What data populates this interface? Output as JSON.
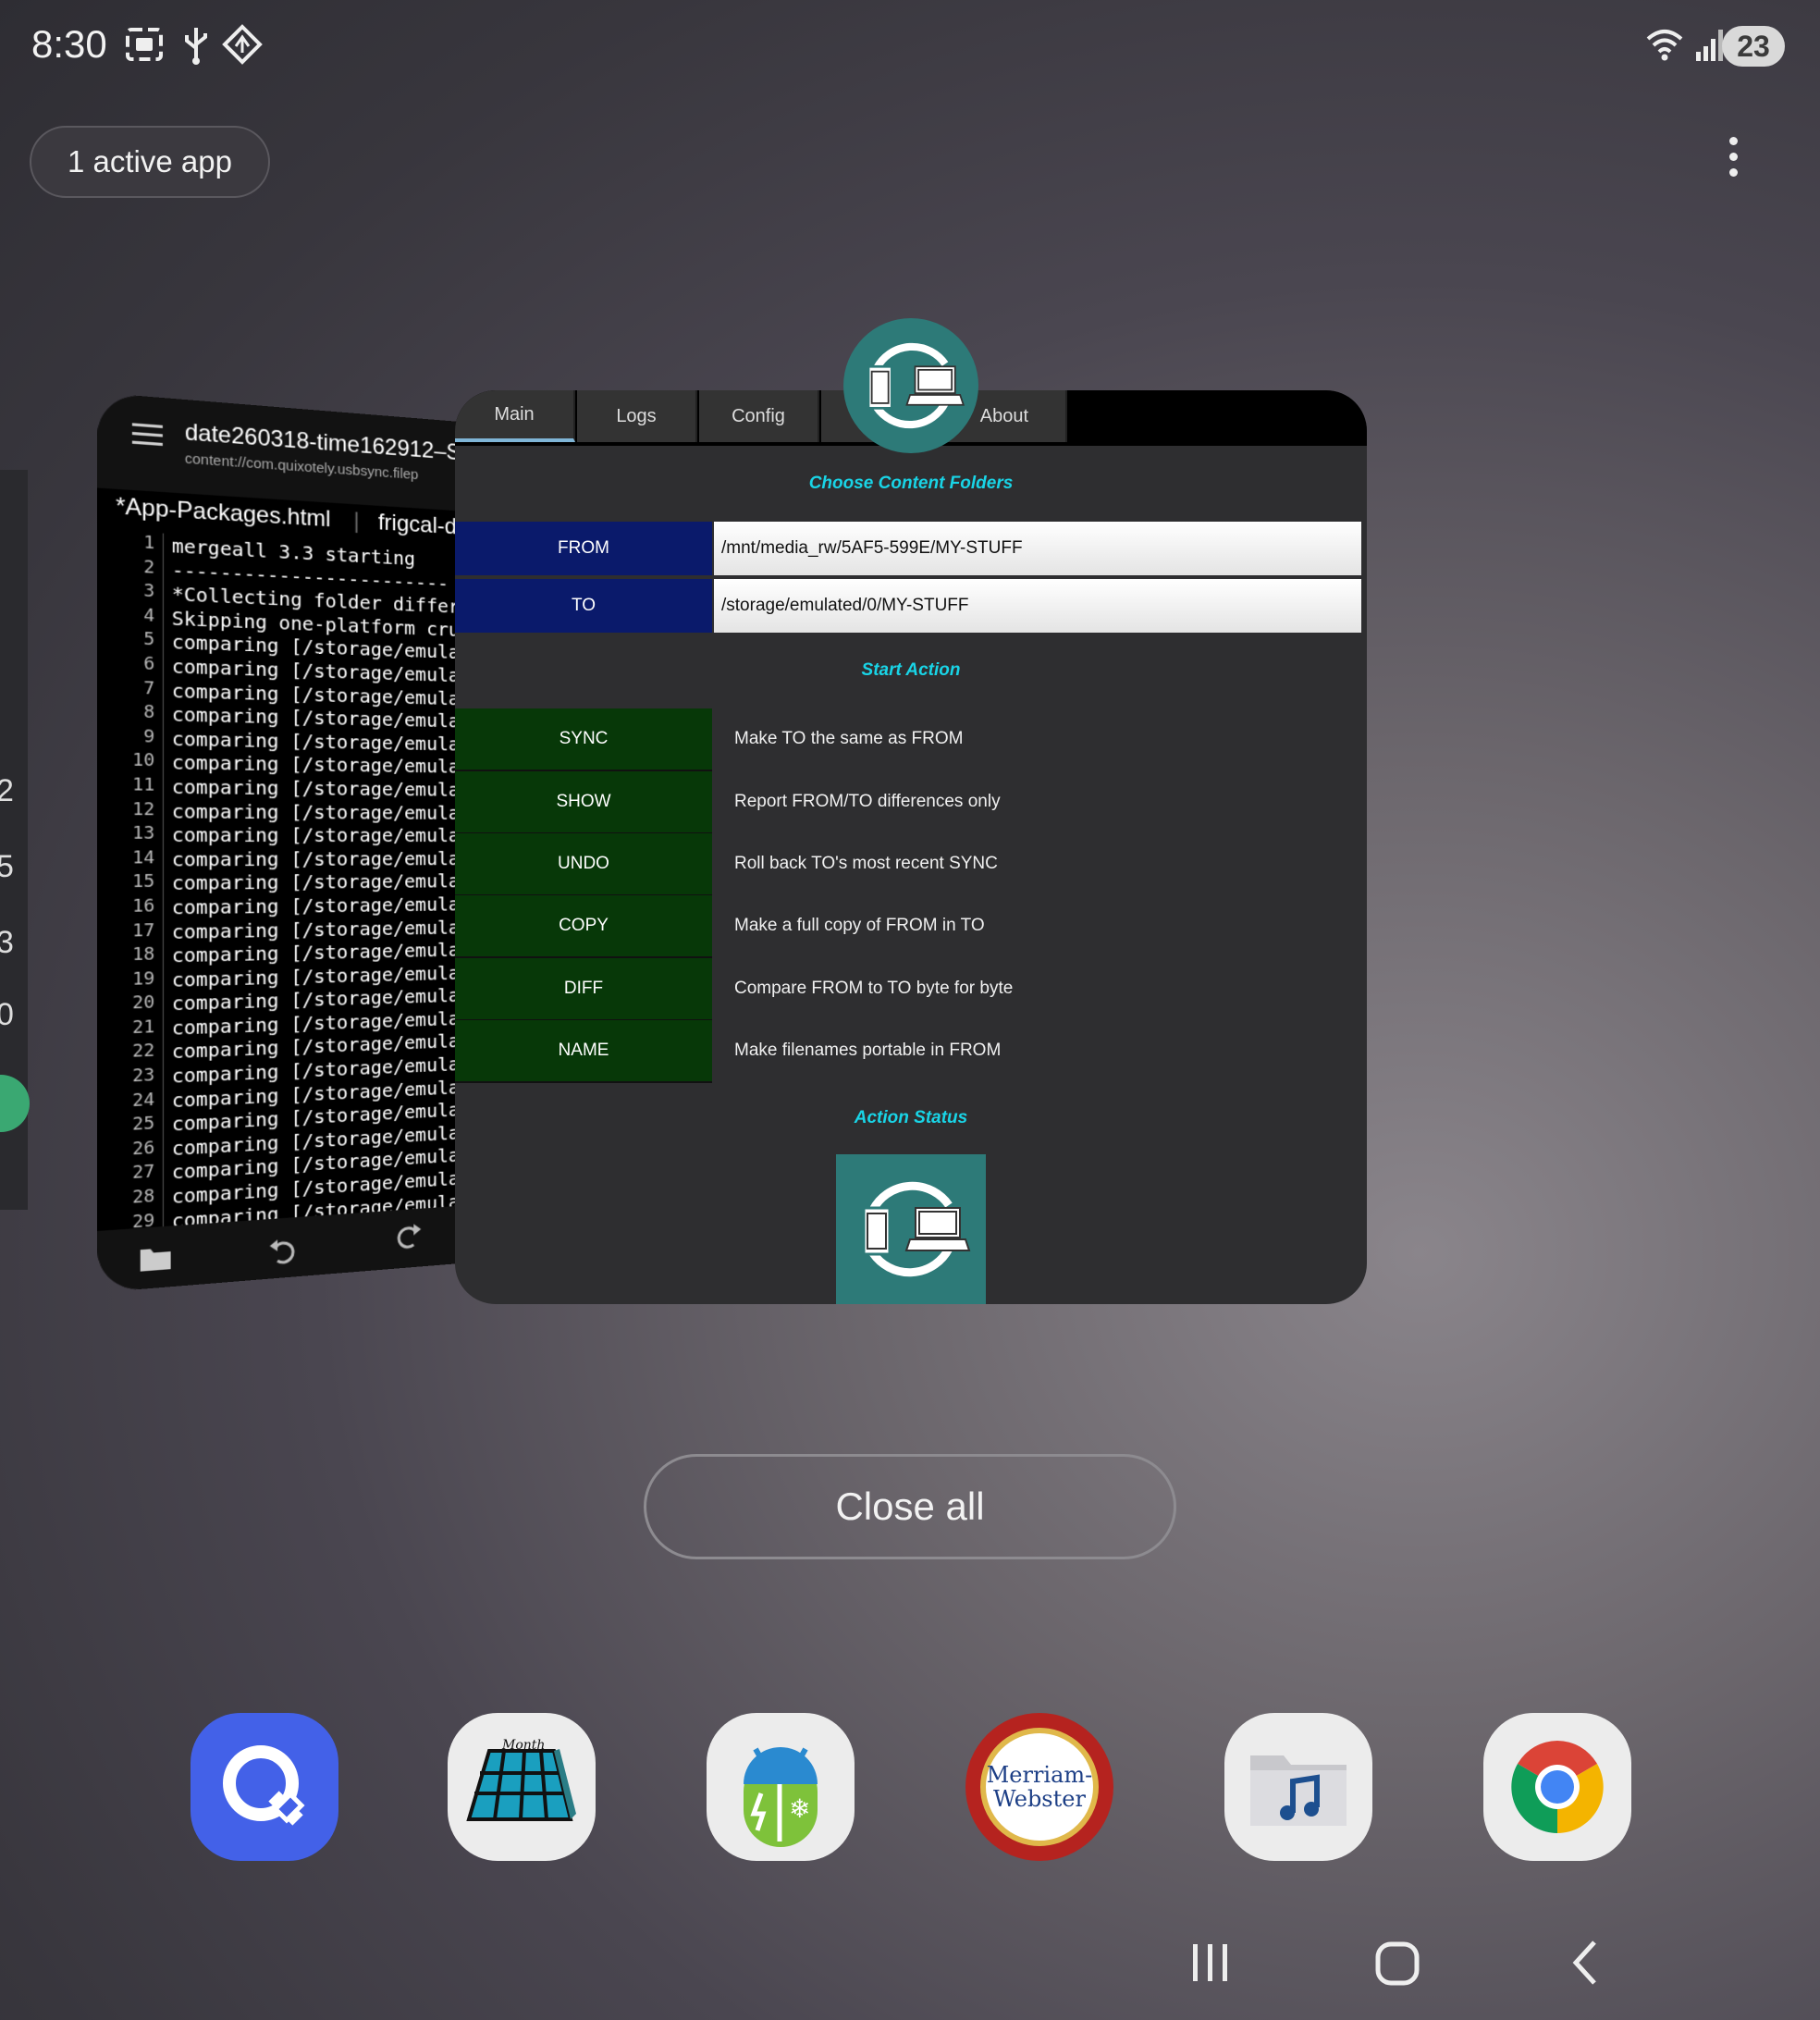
{
  "status_bar": {
    "time": "8:30",
    "battery": "23",
    "icons": [
      "screenshot-icon",
      "usb-icon",
      "location-icon",
      "wifi-6-icon",
      "signal-icon"
    ]
  },
  "recents": {
    "active_apps_label": "1 active app",
    "close_all_label": "Close all"
  },
  "editor_card": {
    "title": "date260318-time162912–S",
    "uri": "content://com.quixotely.usbsync.filep",
    "tabs": [
      "*App-Packages.html",
      "frigcal-de"
    ],
    "lines": [
      {
        "n": "1",
        "t": "mergeall 3.3 starting"
      },
      {
        "n": "2",
        "t": "------------------------"
      },
      {
        "n": "3",
        "t": "*Collecting folder differ"
      },
      {
        "n": "4",
        "t": "Skipping one-platform cru"
      },
      {
        "n": "5",
        "t": "comparing [/storage/emula"
      },
      {
        "n": "6",
        "t": "comparing [/storage/emula"
      },
      {
        "n": "7",
        "t": "comparing [/storage/emula"
      },
      {
        "n": "8",
        "t": "comparing [/storage/emula"
      },
      {
        "n": "9",
        "t": "comparing [/storage/emula"
      },
      {
        "n": "10",
        "t": "comparing [/storage/emula"
      },
      {
        "n": "11",
        "t": "comparing [/storage/emula"
      },
      {
        "n": "12",
        "t": "comparing [/storage/emula"
      },
      {
        "n": "13",
        "t": "comparing [/storage/emula"
      },
      {
        "n": "14",
        "t": "comparing [/storage/emula"
      },
      {
        "n": "15",
        "t": "comparing [/storage/emula"
      },
      {
        "n": "16",
        "t": "comparing [/storage/emula"
      },
      {
        "n": "17",
        "t": "comparing [/storage/emula"
      },
      {
        "n": "18",
        "t": "comparing [/storage/emula"
      },
      {
        "n": "19",
        "t": "comparing [/storage/emula"
      },
      {
        "n": "20",
        "t": "comparing [/storage/emula"
      },
      {
        "n": "21",
        "t": "comparing [/storage/emula"
      },
      {
        "n": "22",
        "t": "comparing [/storage/emula"
      },
      {
        "n": "23",
        "t": "comparing [/storage/emula"
      },
      {
        "n": "24",
        "t": "comparing [/storage/emula"
      },
      {
        "n": "25",
        "t": "comparing [/storage/emula"
      },
      {
        "n": "26",
        "t": "comparing [/storage/emula"
      },
      {
        "n": "27",
        "t": "comparing [/storage/emula"
      },
      {
        "n": "28",
        "t": "comparing [/storage/emula"
      },
      {
        "n": "29",
        "t": "comparing [/storage/emula"
      }
    ]
  },
  "edge_card": {
    "digits": [
      "2",
      "5",
      "3",
      "0"
    ]
  },
  "main_card": {
    "tabs": [
      "Main",
      "Logs",
      "Config",
      "About"
    ],
    "choose_title": "Choose Content Folders",
    "from_label": "FROM",
    "from_path": "/mnt/media_rw/5AF5-599E/MY-STUFF",
    "to_label": "TO",
    "to_path": "/storage/emulated/0/MY-STUFF",
    "start_title": "Start Action",
    "actions": [
      {
        "label": "SYNC",
        "desc": "Make TO the same as FROM"
      },
      {
        "label": "SHOW",
        "desc": "Report FROM/TO differences only"
      },
      {
        "label": "UNDO",
        "desc": "Roll back TO's most recent SYNC"
      },
      {
        "label": "COPY",
        "desc": "Make a full copy of FROM in TO"
      },
      {
        "label": "DIFF",
        "desc": "Compare FROM to TO byte for byte"
      },
      {
        "label": "NAME",
        "desc": "Make filenames portable in FROM"
      }
    ],
    "status_title": "Action Status"
  },
  "dock": {
    "apps": [
      "quickedit-icon",
      "month-calendar-icon",
      "weatherbug-icon",
      "merriam-webster-icon",
      "music-folder-icon",
      "chrome-icon"
    ],
    "merriam_text_1": "Merriam-",
    "merriam_text_2": "Webster",
    "month_text": "Month"
  },
  "colors": {
    "accent_cyan": "#19d4e6",
    "folder_label_bg": "#0a1a6b",
    "action_btn_bg": "#073808",
    "app_teal": "#2d7a78"
  }
}
